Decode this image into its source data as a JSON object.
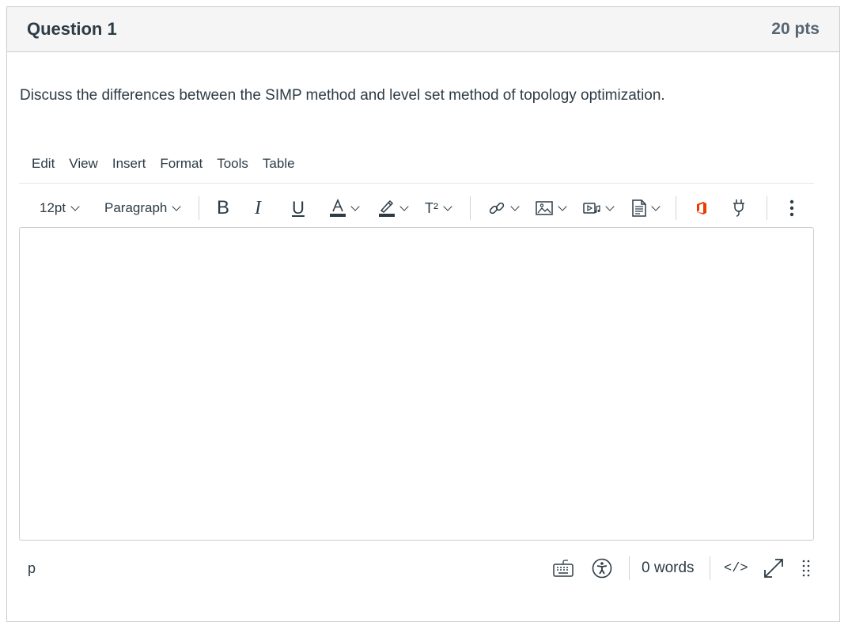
{
  "question": {
    "title": "Question 1",
    "points": "20 pts",
    "text": "Discuss the differences between the SIMP method and level set method of topology optimization."
  },
  "menubar": [
    "Edit",
    "View",
    "Insert",
    "Format",
    "Tools",
    "Table"
  ],
  "toolbar": {
    "font_size": "12pt",
    "block_format": "Paragraph",
    "icons": [
      "bold-icon",
      "italic-icon",
      "underline-icon",
      "text-color-icon",
      "highlight-color-icon",
      "superscript-icon",
      "link-icon",
      "image-icon",
      "media-icon",
      "document-icon",
      "office365-icon",
      "plugin-icon",
      "more-icon"
    ],
    "superscript_label": "T²"
  },
  "editor": {
    "content": ""
  },
  "statusbar": {
    "path": "p",
    "word_count": "0 words",
    "html_editor_label": "</>",
    "icons": [
      "keyboard-shortcuts-icon",
      "accessibility-checker-icon",
      "fullscreen-icon",
      "resize-handle-icon"
    ]
  },
  "colors": {
    "text": "#2d3b45",
    "header_bg": "#f5f5f5",
    "border": "#c7cdd1",
    "office_orange": "#eb3c00"
  }
}
